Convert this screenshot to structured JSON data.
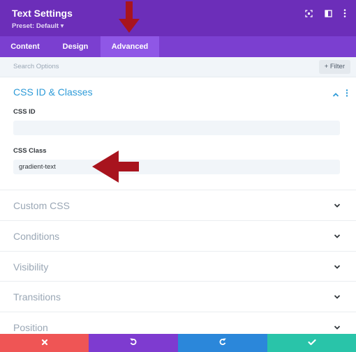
{
  "header": {
    "title": "Text Settings",
    "preset": "Preset: Default ▾"
  },
  "tabs": [
    {
      "label": "Content",
      "active": false
    },
    {
      "label": "Design",
      "active": false
    },
    {
      "label": "Advanced",
      "active": true
    }
  ],
  "search": {
    "placeholder": "Search Options",
    "filter_label": "+ Filter"
  },
  "css_section": {
    "title": "CSS ID & Classes",
    "css_id_label": "CSS ID",
    "css_id_value": "",
    "css_class_label": "CSS Class",
    "css_class_value": "gradient-text"
  },
  "sections": [
    {
      "title": "Custom CSS"
    },
    {
      "title": "Conditions"
    },
    {
      "title": "Visibility"
    },
    {
      "title": "Transitions"
    },
    {
      "title": "Position"
    }
  ],
  "colors": {
    "header": "#6c2eb9",
    "tabs": "#7b3fd0",
    "active_tab": "#8f57e6",
    "accent": "#2e9bd8",
    "arrow": "#a8141e",
    "discard": "#ef5555",
    "undo": "#7e3bd0",
    "redo": "#2b87da",
    "save": "#29c4a9"
  },
  "footer": {
    "buttons": [
      {
        "name": "discard",
        "icon": "close-icon"
      },
      {
        "name": "undo",
        "icon": "undo-icon"
      },
      {
        "name": "redo",
        "icon": "redo-icon"
      },
      {
        "name": "save",
        "icon": "check-icon"
      }
    ]
  }
}
